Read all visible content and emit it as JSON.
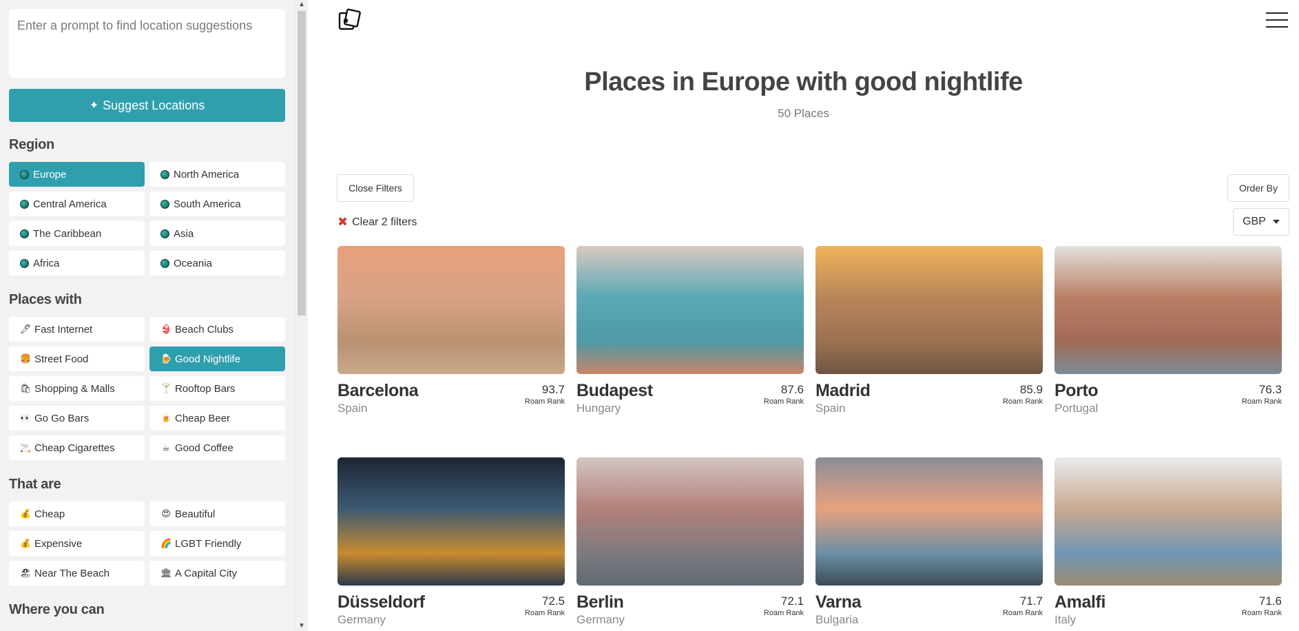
{
  "sidebar": {
    "prompt_placeholder": "Enter a prompt to find location suggestions",
    "suggest_label": "Suggest Locations",
    "region_title": "Region",
    "regions": [
      {
        "label": "Europe",
        "active": true
      },
      {
        "label": "North America",
        "active": false
      },
      {
        "label": "Central America",
        "active": false
      },
      {
        "label": "South America",
        "active": false
      },
      {
        "label": "The Caribbean",
        "active": false
      },
      {
        "label": "Asia",
        "active": false
      },
      {
        "label": "Africa",
        "active": false
      },
      {
        "label": "Oceania",
        "active": false
      }
    ],
    "places_with_title": "Places with",
    "places_with": [
      {
        "label": "Fast Internet",
        "icon": "🖊"
      },
      {
        "label": "Beach Clubs",
        "icon": "👙"
      },
      {
        "label": "Street Food",
        "icon": "🍔"
      },
      {
        "label": "Good Nightlife",
        "icon": "🍺",
        "active": true
      },
      {
        "label": "Shopping & Malls",
        "icon": "🛍"
      },
      {
        "label": "Rooftop Bars",
        "icon": "🍸"
      },
      {
        "label": "Go Go Bars",
        "icon": "👀"
      },
      {
        "label": "Cheap Beer",
        "icon": "🍺"
      },
      {
        "label": "Cheap Cigarettes",
        "icon": "🚬"
      },
      {
        "label": "Good Coffee",
        "icon": "☕"
      }
    ],
    "that_are_title": "That are",
    "that_are": [
      {
        "label": "Cheap",
        "icon": "💰"
      },
      {
        "label": "Beautiful",
        "icon": "😍"
      },
      {
        "label": "Expensive",
        "icon": "💰"
      },
      {
        "label": "LGBT Friendly",
        "icon": "🌈"
      },
      {
        "label": "Near The Beach",
        "icon": "🏖"
      },
      {
        "label": "A Capital City",
        "icon": "🏛"
      }
    ],
    "where_title": "Where you can"
  },
  "main": {
    "title": "Places in Europe with good nightlife",
    "count": "50 Places",
    "close_filters": "Close Filters",
    "order_by": "Order By",
    "clear_filters": "Clear 2 filters",
    "currency": "GBP",
    "rank_label": "Roam Rank",
    "places": [
      {
        "city": "Barcelona",
        "country": "Spain",
        "score": "93.7",
        "palette": [
          "#e8a07a",
          "#d9a287",
          "#b99272",
          "#c8a88a"
        ]
      },
      {
        "city": "Budapest",
        "country": "Hungary",
        "score": "87.6",
        "palette": [
          "#d9c9c1",
          "#5aa9b5",
          "#4e9aa6",
          "#c98566"
        ]
      },
      {
        "city": "Madrid",
        "country": "Spain",
        "score": "85.9",
        "palette": [
          "#f0b45a",
          "#b8865a",
          "#9c7052",
          "#6e5643"
        ]
      },
      {
        "city": "Porto",
        "country": "Portugal",
        "score": "76.3",
        "palette": [
          "#e3e3df",
          "#b97f65",
          "#a26b58",
          "#7c8b95"
        ]
      },
      {
        "city": "Düsseldorf",
        "country": "Germany",
        "score": "72.5",
        "palette": [
          "#1c2533",
          "#3c5a73",
          "#c98b2f",
          "#2b3a4a"
        ]
      },
      {
        "city": "Berlin",
        "country": "Germany",
        "score": "72.1",
        "palette": [
          "#d3c6c2",
          "#b3807a",
          "#7d7a80",
          "#5f6a72"
        ]
      },
      {
        "city": "Varna",
        "country": "Bulgaria",
        "score": "71.7",
        "palette": [
          "#8b8d99",
          "#e8a17e",
          "#6c8fa4",
          "#3c4c55"
        ]
      },
      {
        "city": "Amalfi",
        "country": "Italy",
        "score": "71.6",
        "palette": [
          "#e8ecef",
          "#c9a98f",
          "#6f97b5",
          "#9b8a73"
        ]
      }
    ]
  }
}
